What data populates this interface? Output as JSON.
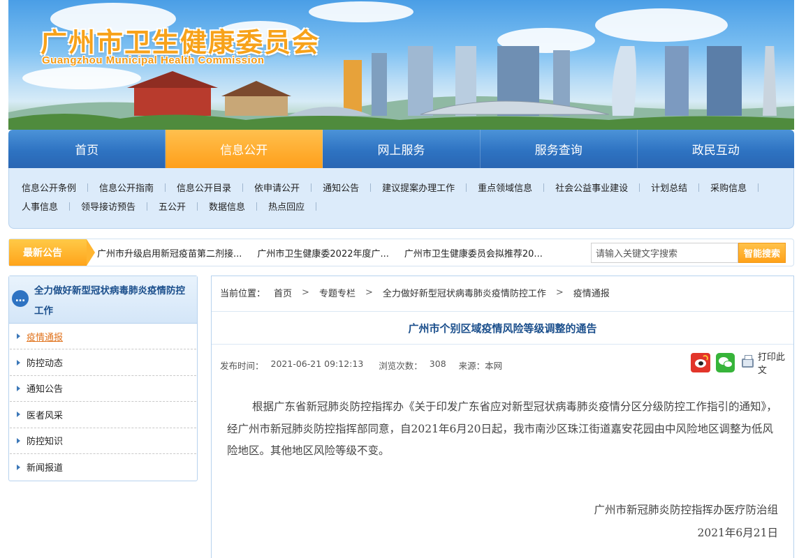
{
  "banner": {
    "title": "广州市卫生健康委员会",
    "subtitle": "Guangzhou Municipal Health Commission"
  },
  "mainnav": [
    "首页",
    "信息公开",
    "网上服务",
    "服务查询",
    "政民互动"
  ],
  "subnav": {
    "row1": [
      "信息公开条例",
      "信息公开指南",
      "信息公开目录",
      "依申请公开",
      "通知公告",
      "建议提案办理工作",
      "重点领域信息",
      "社会公益事业建设",
      "计划总结",
      "采购信息"
    ],
    "row2": [
      "人事信息",
      "领导接访预告",
      "五公开",
      "数据信息",
      "热点回应"
    ]
  },
  "notice": {
    "label": "最新公告",
    "items": [
      "广州市升级启用新冠疫苗第二剂接...",
      "广州市卫生健康委2022年度广...",
      "广州市卫生健康委员会拟推荐20..."
    ],
    "search_placeholder": "请输入关键文字搜索",
    "search_button": "智能搜索"
  },
  "sidebar": {
    "heading": "全力做好新型冠状病毒肺炎疫情防控工作",
    "items": [
      "疫情通报",
      "防控动态",
      "通知公告",
      "医者风采",
      "防控知识",
      "新闻报道"
    ]
  },
  "breadcrumb": {
    "prefix": "当前位置：",
    "items": [
      "首页",
      "专题专栏",
      "全力做好新型冠状病毒肺炎疫情防控工作",
      "疫情通报"
    ],
    "separator": ">"
  },
  "article": {
    "title": "广州市个别区域疫情风险等级调整的通告",
    "publish_label": "发布时间：",
    "publish_time": "2021-06-21 09:12:13",
    "views_label": "浏览次数：",
    "views": "308",
    "source_label": "来源：",
    "source": "本网",
    "print_label": "打印此文",
    "body": "根据广东省新冠肺炎防控指挥办《关于印发广东省应对新型冠状病毒肺炎疫情分区分级防控工作指引的通知》，经广州市新冠肺炎防控指挥部同意，自2021年6月20日起，我市南沙区珠江街道嘉安花园由中风险地区调整为低风险地区。其他地区风险等级不变。",
    "signature_org": "广州市新冠肺炎防控指挥办医疗防治组",
    "signature_date": "2021年6月21日"
  },
  "colors": {
    "nav_blue": "#2e73c2",
    "accent_orange": "#ffa21a",
    "title_blue": "#1b4f8c",
    "active_link": "#e0731d"
  }
}
